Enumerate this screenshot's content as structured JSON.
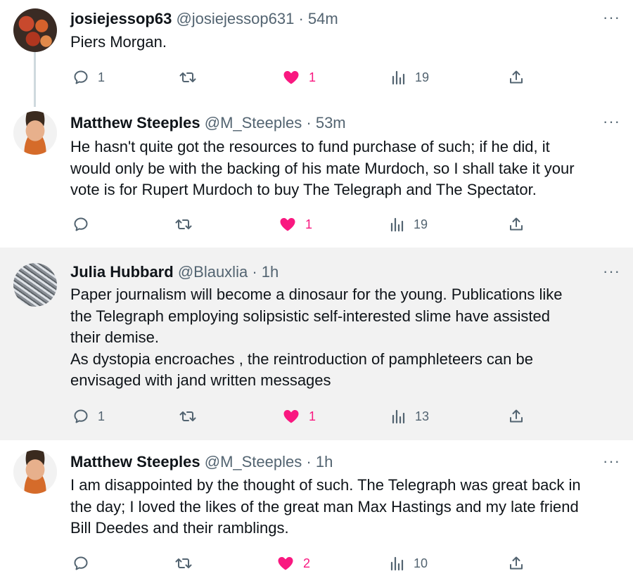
{
  "tweets": [
    {
      "name": "josiejessop63",
      "handle": "@josiejessop631",
      "time": "54m",
      "lines": [
        "Piers Morgan."
      ],
      "replies": "1",
      "retweets": "",
      "likes": "1",
      "views": "19",
      "highlighted": false
    },
    {
      "name": "Matthew Steeples",
      "handle": "@M_Steeples",
      "time": "53m",
      "lines": [
        "He hasn't quite got the resources to fund purchase of such; if he did, it",
        "would only be with the backing of his mate Murdoch, so I shall take it your",
        "vote is for Rupert Murdoch to buy The Telegraph and The Spectator."
      ],
      "replies": "",
      "retweets": "",
      "likes": "1",
      "views": "19",
      "highlighted": false
    },
    {
      "name": "Julia Hubbard",
      "handle": "@Blauxlia",
      "time": "1h",
      "lines": [
        "Paper journalism will become a dinosaur for the young. Publications like",
        "the Telegraph employing solipsistic self-interested slime have assisted",
        "their demise.",
        "As dystopia encroaches , the reintroduction of pamphleteers  can be",
        "envisaged with jand written messages"
      ],
      "replies": "1",
      "retweets": "",
      "likes": "1",
      "views": "13",
      "highlighted": true
    },
    {
      "name": "Matthew Steeples",
      "handle": "@M_Steeples",
      "time": "1h",
      "lines": [
        "I am disappointed by the thought of such. The Telegraph was great back in",
        "the day; I loved the likes of the great man Max Hastings and my late friend",
        "Bill Deedes and their ramblings."
      ],
      "replies": "",
      "retweets": "",
      "likes": "2",
      "views": "10",
      "highlighted": false
    }
  ],
  "separator": "·",
  "more_label": "···",
  "icons": {
    "reply": "reply-icon",
    "retweet": "retweet-icon",
    "like": "heart-icon",
    "views": "views-icon",
    "share": "share-icon"
  },
  "colors": {
    "like": "#f91880",
    "muted": "#536471",
    "text": "#0f1419",
    "highlight_bg": "#f2f2f2"
  }
}
